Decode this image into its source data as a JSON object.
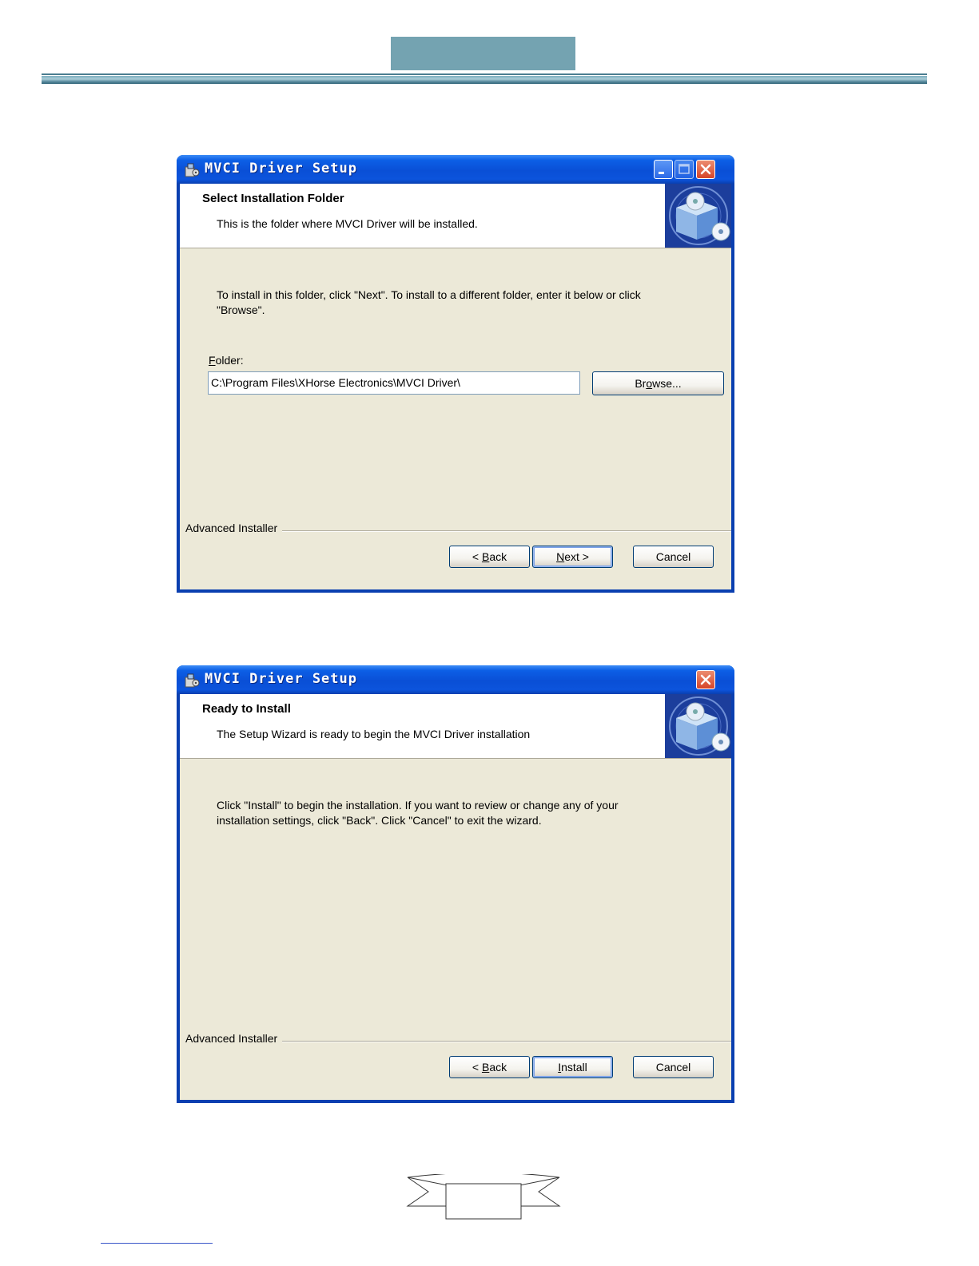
{
  "dialogs": [
    {
      "title": "MVCI Driver Setup",
      "banner_title": "Select Installation Folder",
      "banner_subtitle": "This is the folder where MVCI Driver will be installed.",
      "body_line1": "To install in this folder, click \"Next\". To install to a different folder, enter it below or click",
      "body_line2": "\"Browse\".",
      "folder_label_accel": "F",
      "folder_label_rest": "older:",
      "folder_value": "C:\\Program Files\\XHorse Electronics\\MVCI Driver\\",
      "browse_pre": "Br",
      "browse_accel": "o",
      "browse_post": "wse...",
      "footer_label": "Advanced Installer",
      "back_pre": "< ",
      "back_accel": "B",
      "back_post": "ack",
      "next_accel": "N",
      "next_post": "ext >",
      "cancel_label": "Cancel"
    },
    {
      "title": "MVCI Driver Setup",
      "banner_title": "Ready to Install",
      "banner_subtitle": "The Setup Wizard is ready to begin the MVCI Driver installation",
      "body_line1": "Click \"Install\" to begin the installation.  If you want to review or change any of your",
      "body_line2": "installation settings, click \"Back\".  Click \"Cancel\" to exit the wizard.",
      "footer_label": "Advanced Installer",
      "back_pre": "< ",
      "back_accel": "B",
      "back_post": "ack",
      "install_accel": "I",
      "install_post": "nstall",
      "cancel_label": "Cancel"
    }
  ],
  "colors": {
    "header_accent": "#74a3b1",
    "xp_title_blue": "#0a4fd6",
    "dialog_face": "#ece9d8"
  }
}
